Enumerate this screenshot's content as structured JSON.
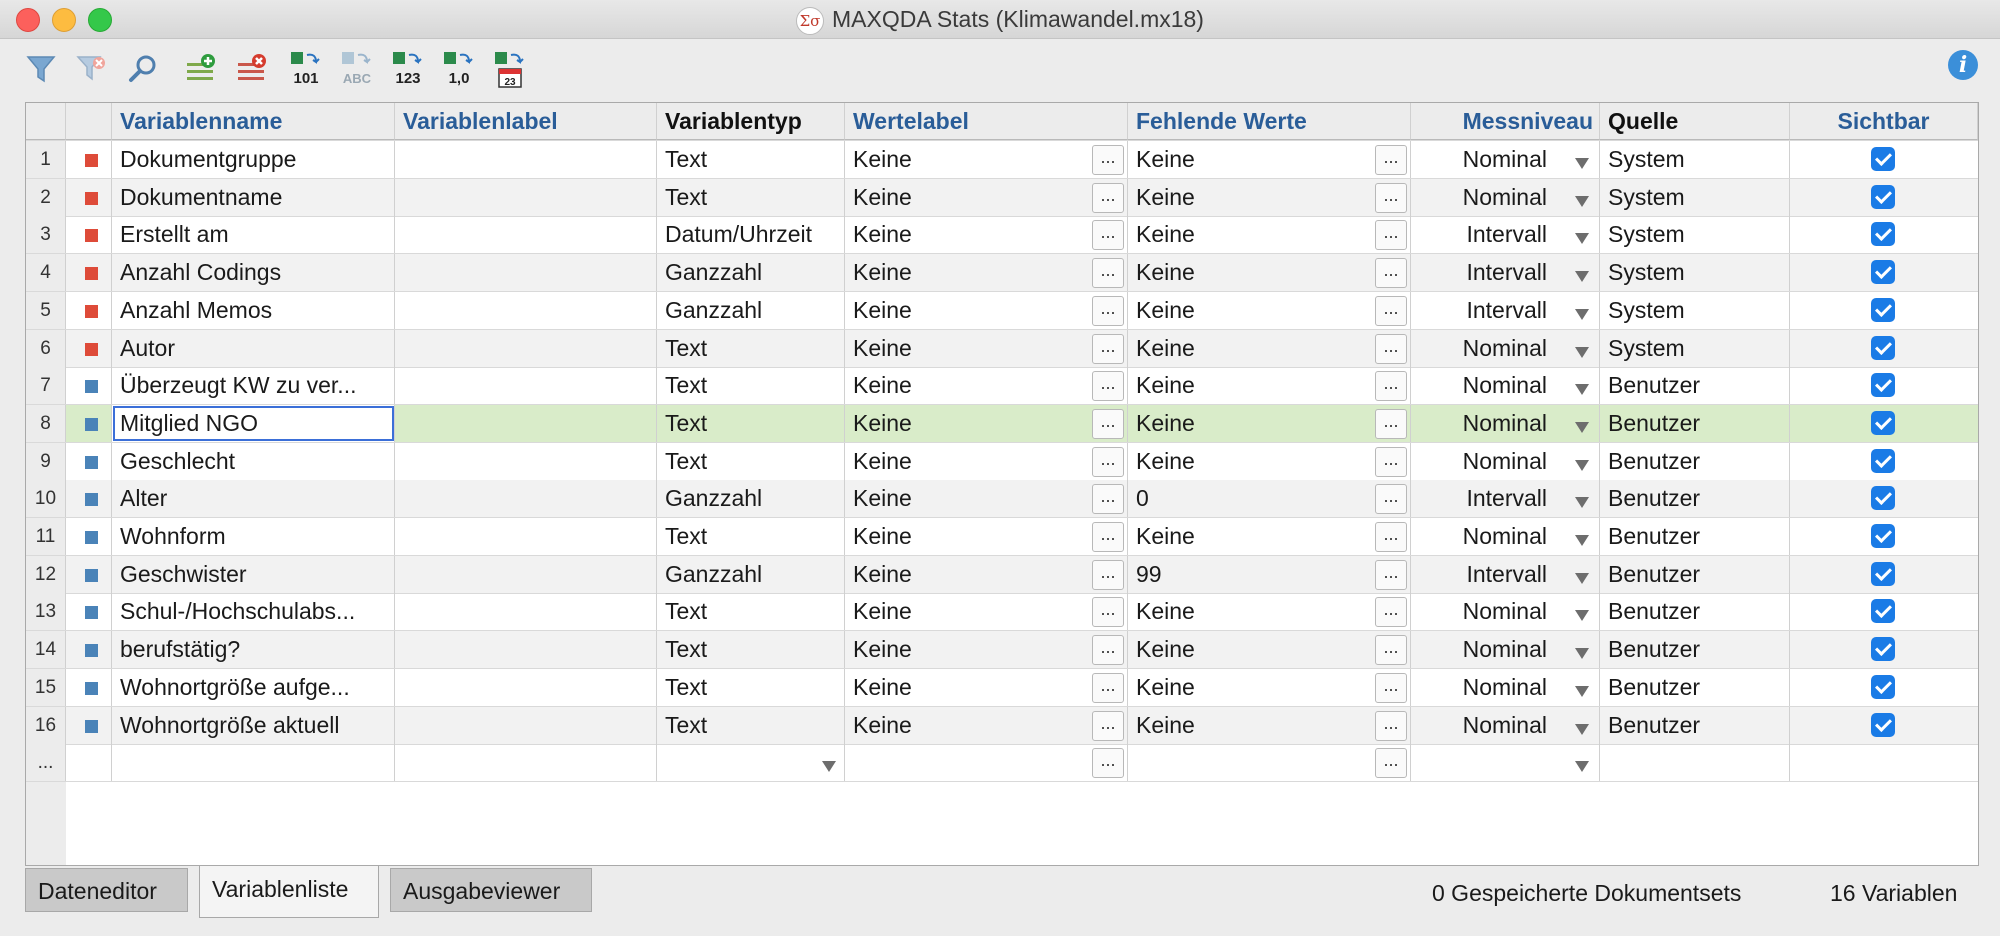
{
  "window": {
    "title": "MAXQDA Stats (Klimawandel.mx18)",
    "app_icon": "Σσ"
  },
  "colors": {
    "system_marker": "#de4b39",
    "user_marker": "#4a83b8",
    "header_text": "#2a5d98",
    "selected_row": "#d9ecc9",
    "checkbox": "#1a7be6"
  },
  "toolbar": {
    "icons": [
      "filter-icon",
      "clear-filter-icon",
      "search-icon",
      "add-variable-icon",
      "delete-variable-icon",
      "convert-to-integer-icon",
      "convert-to-text-icon",
      "convert-to-number-icon",
      "convert-to-decimal-icon",
      "convert-to-date-icon"
    ],
    "convert_labels": [
      "101",
      "ABC",
      "123",
      "1,0",
      "23"
    ],
    "info": "i"
  },
  "columns": {
    "varname": "Variablenname",
    "varlabel": "Variablenlabel",
    "vartype": "Variablentyp",
    "valuelabel": "Wertelabel",
    "missing": "Fehlende Werte",
    "level": "Messniveau",
    "source": "Quelle",
    "visible": "Sichtbar"
  },
  "rows": [
    {
      "n": "1",
      "name": "Dokumentgruppe",
      "label": "",
      "type": "Text",
      "valuelabel": "Keine",
      "missing": "Keine",
      "level": "Nominal",
      "source": "System",
      "visible": true
    },
    {
      "n": "2",
      "name": "Dokumentname",
      "label": "",
      "type": "Text",
      "valuelabel": "Keine",
      "missing": "Keine",
      "level": "Nominal",
      "source": "System",
      "visible": true
    },
    {
      "n": "3",
      "name": "Erstellt am",
      "label": "",
      "type": "Datum/Uhrzeit",
      "valuelabel": "Keine",
      "missing": "Keine",
      "level": "Intervall",
      "source": "System",
      "visible": true
    },
    {
      "n": "4",
      "name": "Anzahl Codings",
      "label": "",
      "type": "Ganzzahl",
      "valuelabel": "Keine",
      "missing": "Keine",
      "level": "Intervall",
      "source": "System",
      "visible": true
    },
    {
      "n": "5",
      "name": "Anzahl Memos",
      "label": "",
      "type": "Ganzzahl",
      "valuelabel": "Keine",
      "missing": "Keine",
      "level": "Intervall",
      "source": "System",
      "visible": true
    },
    {
      "n": "6",
      "name": "Autor",
      "label": "",
      "type": "Text",
      "valuelabel": "Keine",
      "missing": "Keine",
      "level": "Nominal",
      "source": "System",
      "visible": true
    },
    {
      "n": "7",
      "name": "Überzeugt KW zu ver...",
      "label": "",
      "type": "Text",
      "valuelabel": "Keine",
      "missing": "Keine",
      "level": "Nominal",
      "source": "Benutzer",
      "visible": true
    },
    {
      "n": "8",
      "name": "Mitglied NGO",
      "label": "",
      "type": "Text",
      "valuelabel": "Keine",
      "missing": "Keine",
      "level": "Nominal",
      "source": "Benutzer",
      "visible": true
    },
    {
      "n": "9",
      "name": "Geschlecht",
      "label": "",
      "type": "Text",
      "valuelabel": "Keine",
      "missing": "Keine",
      "level": "Nominal",
      "source": "Benutzer",
      "visible": true
    },
    {
      "n": "10",
      "name": "Alter",
      "label": "",
      "type": "Ganzzahl",
      "valuelabel": "Keine",
      "missing": "0",
      "level": "Intervall",
      "source": "Benutzer",
      "visible": true
    },
    {
      "n": "11",
      "name": "Wohnform",
      "label": "",
      "type": "Text",
      "valuelabel": "Keine",
      "missing": "Keine",
      "level": "Nominal",
      "source": "Benutzer",
      "visible": true
    },
    {
      "n": "12",
      "name": "Geschwister",
      "label": "",
      "type": "Ganzzahl",
      "valuelabel": "Keine",
      "missing": "99",
      "level": "Intervall",
      "source": "Benutzer",
      "visible": true
    },
    {
      "n": "13",
      "name": "Schul-/Hochschulabs...",
      "label": "",
      "type": "Text",
      "valuelabel": "Keine",
      "missing": "Keine",
      "level": "Nominal",
      "source": "Benutzer",
      "visible": true
    },
    {
      "n": "14",
      "name": "berufstätig?",
      "label": "",
      "type": "Text",
      "valuelabel": "Keine",
      "missing": "Keine",
      "level": "Nominal",
      "source": "Benutzer",
      "visible": true
    },
    {
      "n": "15",
      "name": "Wohnortgröße aufge...",
      "label": "",
      "type": "Text",
      "valuelabel": "Keine",
      "missing": "Keine",
      "level": "Nominal",
      "source": "Benutzer",
      "visible": true
    },
    {
      "n": "16",
      "name": "Wohnortgröße aktuell",
      "label": "",
      "type": "Text",
      "valuelabel": "Keine",
      "missing": "Keine",
      "level": "Nominal",
      "source": "Benutzer",
      "visible": true
    }
  ],
  "new_row": {
    "n": "...",
    "ellipsis": "..."
  },
  "tabs": [
    "Dateneditor",
    "Variablenliste",
    "Ausgabeviewer"
  ],
  "status": {
    "docsets": "0 Gespeicherte Dokumentsets",
    "variables": "16 Variablen"
  }
}
